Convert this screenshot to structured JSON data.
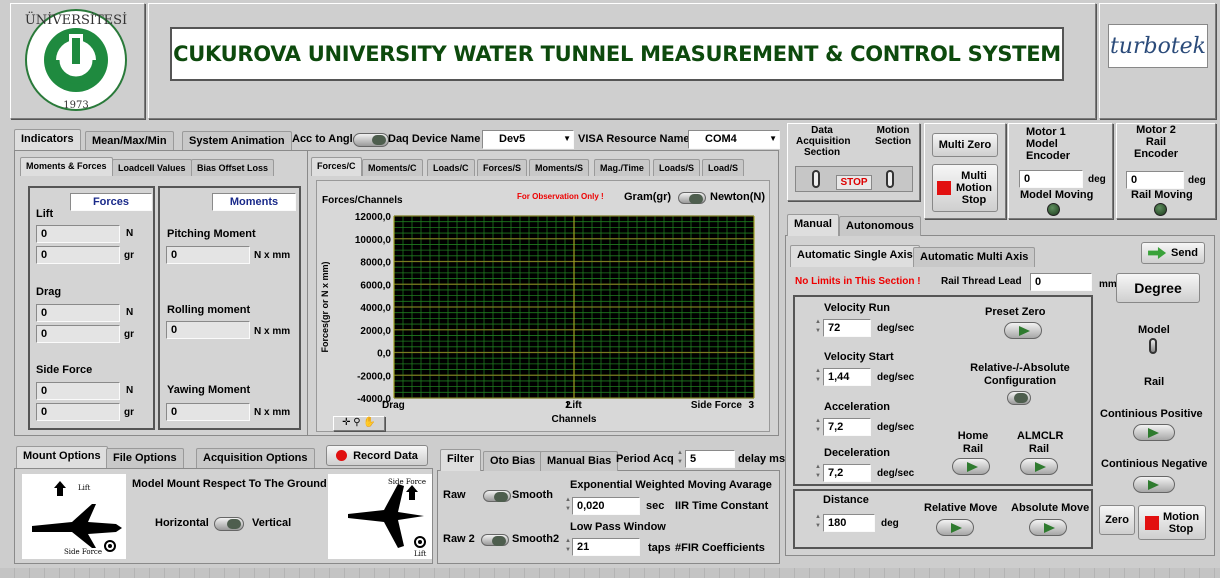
{
  "header": {
    "title": "CUKUROVA UNIVERSITY WATER TUNNEL MEASUREMENT & CONTROL SYSTEM",
    "logo_text_top": "ÜNİVERSİTESİ",
    "logo_left": "ÇUKUROVA",
    "logo_year": "1973",
    "brand": "turbotek"
  },
  "top_tabs": [
    "Indicators",
    "Mean/Max/Min",
    "System Animation"
  ],
  "acc": {
    "label": "Acc to Angle",
    "daq_label": "Daq Device Name",
    "daq_value": "Dev5",
    "visa_label": "VISA Resource Name",
    "visa_value": "COM4"
  },
  "sub_tabs_left": [
    "Moments & Forces",
    "Loadcell Values",
    "Bias Offset Loss"
  ],
  "forces": {
    "header": "Forces",
    "lift": "Lift",
    "drag": "Drag",
    "side": "Side Force",
    "values": [
      "0",
      "0",
      "0",
      "0",
      "0",
      "0"
    ],
    "units": [
      "N",
      "gr",
      "N",
      "gr",
      "N",
      "gr"
    ]
  },
  "moments": {
    "header": "Moments",
    "pitch": "Pitching Moment",
    "roll": "Rolling moment",
    "yaw": "Yawing Moment",
    "values": [
      "0",
      "0",
      "0"
    ],
    "unit": "N x mm"
  },
  "graph_tabs": [
    "Forces/C",
    "Moments/C",
    "Loads/C",
    "Forces/S",
    "Moments/S",
    "Mag./Time",
    "Loads/S",
    "Load/S"
  ],
  "graph": {
    "title": "Forces/Channels",
    "observe": "For Observation Only !",
    "gram": "Gram(gr)",
    "newton": "Newton(N)",
    "xlabel": "Channels",
    "ylabel": "Forces(gr or N x mm)"
  },
  "chart_data": {
    "type": "line",
    "title": "Forces/Channels",
    "xlabel": "Channels",
    "ylabel": "Forces(gr or N x mm)",
    "ylim": [
      -4000,
      12000
    ],
    "yticks": [
      "12000,0",
      "10000,0",
      "8000,0",
      "6000,0",
      "4000,0",
      "2000,0",
      "0,0",
      "-2000,0",
      "-4000,0"
    ],
    "xticks": [
      "Drag",
      "Lift",
      "Side Force"
    ],
    "xtick_nums": [
      "",
      "2",
      "3"
    ],
    "grid": true,
    "series": []
  },
  "bottom_tabs": [
    "Mount Options",
    "File Options",
    "Acquisition Options"
  ],
  "record": "Record Data",
  "mount": {
    "title": "Model Mount Respect To The Ground",
    "horizontal": "Horizontal",
    "vertical": "Vertical",
    "lift": "Lift",
    "side": "Side Force"
  },
  "filter_tabs": [
    "Filter",
    "Oto Bias",
    "Manual Bias"
  ],
  "period": {
    "label": "Period Acq",
    "value": "5",
    "unit": "delay ms"
  },
  "filter": {
    "raw": "Raw",
    "smooth": "Smooth",
    "ewma": "Exponential Weighted Moving Avarage",
    "ewma_value": "0,020",
    "ewma_unit": "sec",
    "iir": "IIR Time Constant",
    "raw2": "Raw 2",
    "smooth2": "Smooth2",
    "lpw": "Low Pass Window",
    "lpw_value": "21",
    "lpw_unit": "taps",
    "fir": "#FIR Coefficients"
  },
  "section": {
    "data": "Data Acquisition Section",
    "motion": "Motion Section",
    "stop": "STOP"
  },
  "multi_zero": "Multi Zero",
  "multi_stop": "Multi Motion Stop",
  "motor1": {
    "title": "Motor 1 Model Encoder",
    "value": "0",
    "unit": "deg",
    "status": "Model Moving"
  },
  "motor2": {
    "title": "Motor 2 Rail Encoder",
    "value": "0",
    "unit": "deg",
    "status": "Rail Moving"
  },
  "mode_tabs": [
    "Manual",
    "Autonomous"
  ],
  "axis_tabs": [
    "Automatic Single Axis",
    "Automatic Multi Axis"
  ],
  "send": "Send",
  "nolimits": "No Limits in This Section !",
  "rail_lead": {
    "label": "Rail Thread Lead",
    "value": "0",
    "unit": "mm"
  },
  "degree": "Degree",
  "vel_run": {
    "label": "Velocity Run",
    "value": "72",
    "unit": "deg/sec"
  },
  "vel_start": {
    "label": "Velocity Start",
    "value": "1,44",
    "unit": "deg/sec"
  },
  "accel": {
    "label": "Acceleration",
    "value": "7,2",
    "unit": "deg/sec"
  },
  "decel": {
    "label": "Deceleration",
    "value": "7,2",
    "unit": "deg/sec"
  },
  "preset": "Preset Zero",
  "relabs": "Relative-/-Absolute Configuration",
  "home": "Home Rail",
  "almclr": "ALMCLR Rail",
  "distance": {
    "label": "Distance",
    "value": "180",
    "unit": "deg"
  },
  "relmove": "Relative Move",
  "absmove": "Absolute Move",
  "model": "Model",
  "rail": "Rail",
  "cpos": "Continious Positive",
  "cneg": "Continious Negative",
  "zero": "Zero",
  "motion_stop": "Motion Stop"
}
